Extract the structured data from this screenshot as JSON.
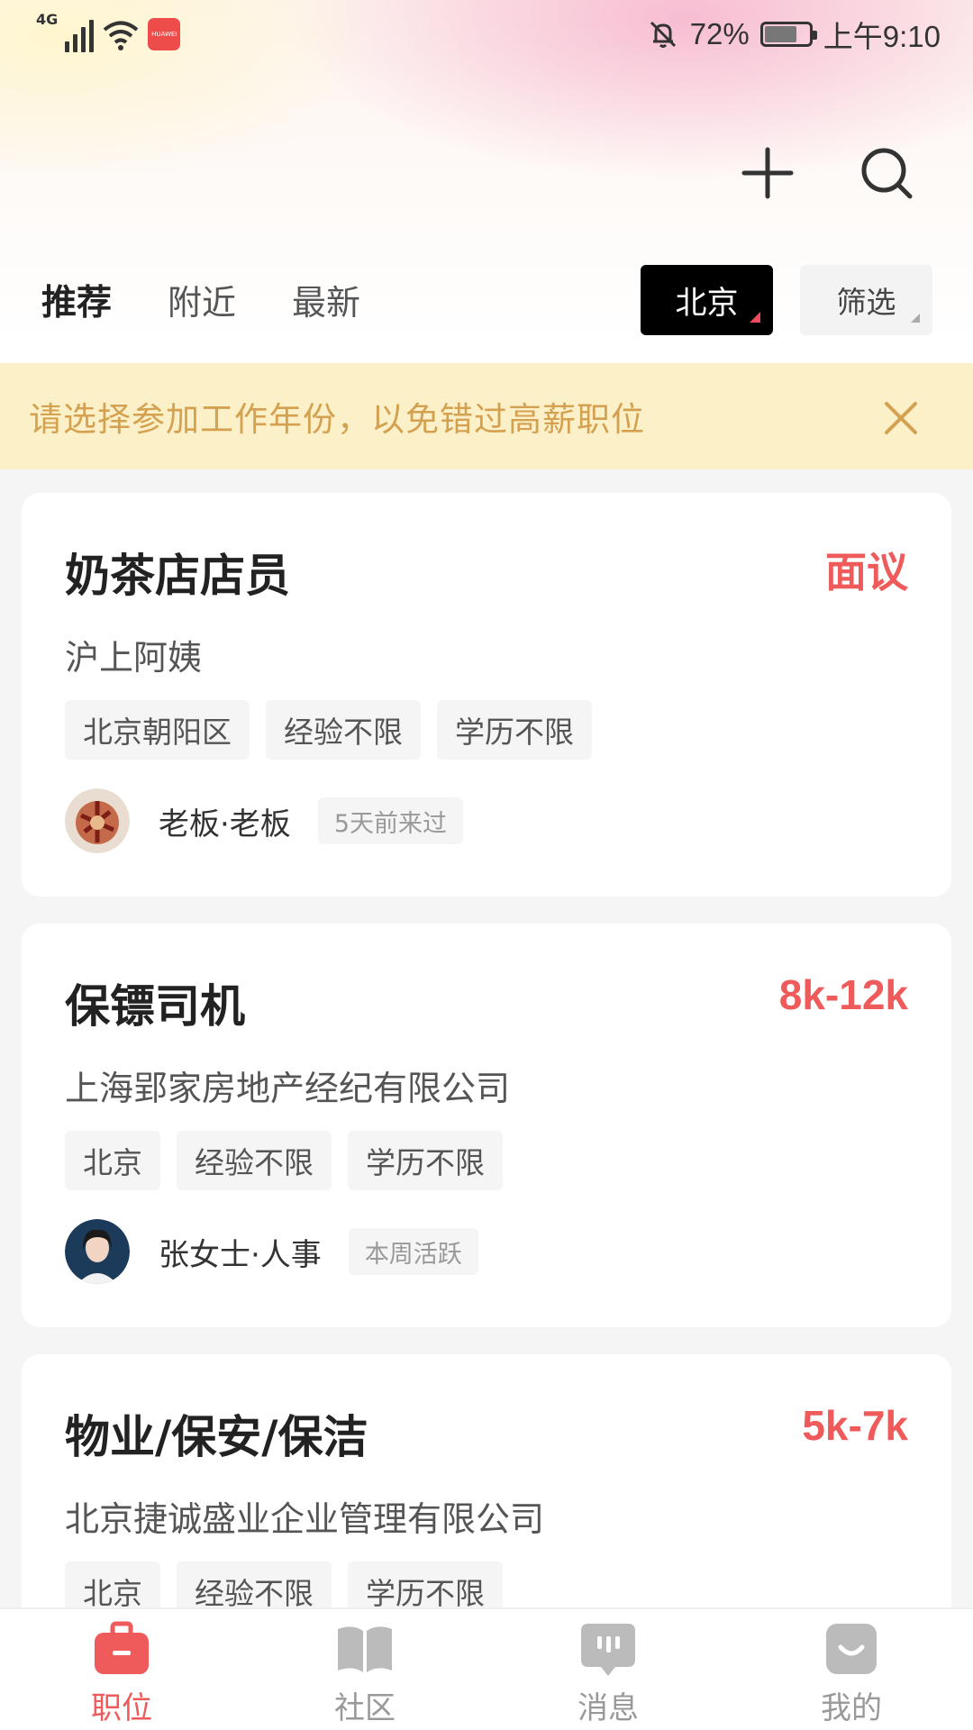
{
  "status_bar": {
    "network": "4G",
    "battery_percent": "72%",
    "battery_level": 0.72,
    "time": "上午9:10",
    "app_badge": "HUAWEI"
  },
  "header": {
    "add_icon": "plus-icon",
    "search_icon": "search-icon"
  },
  "tabs": [
    {
      "label": "推荐",
      "active": true
    },
    {
      "label": "附近",
      "active": false
    },
    {
      "label": "最新",
      "active": false
    }
  ],
  "city_selector": {
    "label": "北京"
  },
  "filter": {
    "label": "筛选"
  },
  "notice": {
    "text": "请选择参加工作年份，以免错过高薪职位"
  },
  "jobs": [
    {
      "title": "奶茶店店员",
      "salary": "面议",
      "company": "沪上阿姨",
      "tags": [
        "北京朝阳区",
        "经验不限",
        "学历不限"
      ],
      "recruiter": "老板·老板",
      "activity": "5天前来过"
    },
    {
      "title": "保镖司机",
      "salary": "8k-12k",
      "company": "上海郢家房地产经纪有限公司",
      "tags": [
        "北京",
        "经验不限",
        "学历不限"
      ],
      "recruiter": "张女士·人事",
      "activity": "本周活跃"
    },
    {
      "title": "物业/保安/保洁",
      "salary": "5k-7k",
      "company": "北京捷诚盛业企业管理有限公司",
      "tags": [
        "北京",
        "经验不限",
        "学历不限"
      ],
      "recruiter": "",
      "activity": ""
    }
  ],
  "bottom_nav": [
    {
      "label": "职位",
      "icon": "briefcase-icon",
      "active": true
    },
    {
      "label": "社区",
      "icon": "book-icon",
      "active": false
    },
    {
      "label": "消息",
      "icon": "message-icon",
      "active": false
    },
    {
      "label": "我的",
      "icon": "profile-icon",
      "active": false
    }
  ],
  "colors": {
    "accent": "#ef5a5a",
    "notice_bg": "#fbf0c8",
    "notice_text": "#d4a150"
  }
}
